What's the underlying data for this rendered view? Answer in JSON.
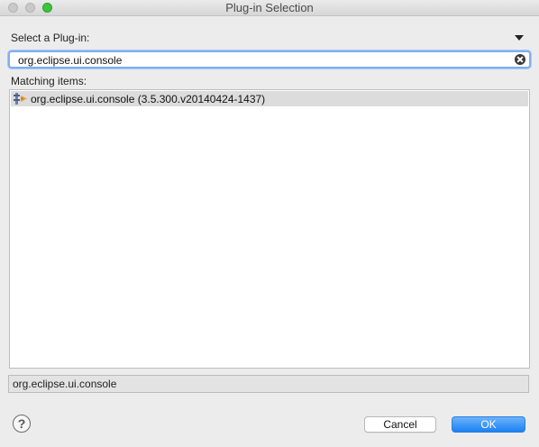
{
  "window": {
    "title": "Plug-in Selection"
  },
  "selector": {
    "label": "Select a Plug-in:",
    "filter_value": "org.eclipse.ui.console",
    "filter_placeholder": ""
  },
  "matches": {
    "label": "Matching items:",
    "items": [
      {
        "label": "org.eclipse.ui.console (3.5.300.v20140424-1437)",
        "selected": true
      }
    ]
  },
  "status": {
    "text": "org.eclipse.ui.console"
  },
  "buttons": {
    "help_glyph": "?",
    "cancel_label": "Cancel",
    "ok_label": "OK"
  },
  "colors": {
    "accent": "#1b80f3",
    "selection": "#dcdcdc"
  },
  "icons": {
    "history": "chevron-down-icon",
    "clear": "clear-circle-icon",
    "plugin": "plugin-icon",
    "help": "help-icon"
  }
}
